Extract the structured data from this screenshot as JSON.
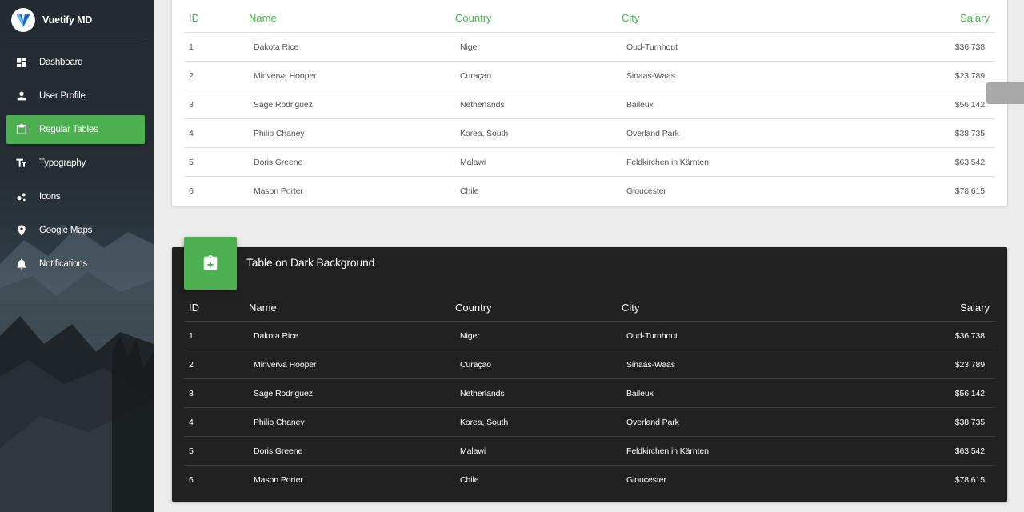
{
  "app": {
    "title": "Vuetify MD",
    "accent": "#4caf50"
  },
  "sidebar": {
    "items": [
      {
        "label": "Dashboard",
        "icon": "dashboard-icon",
        "active": false
      },
      {
        "label": "User Profile",
        "icon": "person-icon",
        "active": false
      },
      {
        "label": "Regular Tables",
        "icon": "clipboard-icon",
        "active": true
      },
      {
        "label": "Typography",
        "icon": "typography-icon",
        "active": false
      },
      {
        "label": "Icons",
        "icon": "bubble-chart-icon",
        "active": false
      },
      {
        "label": "Google Maps",
        "icon": "map-pin-icon",
        "active": false
      },
      {
        "label": "Notifications",
        "icon": "bell-icon",
        "active": false
      }
    ]
  },
  "light_table": {
    "headers": {
      "id": "ID",
      "name": "Name",
      "country": "Country",
      "city": "City",
      "salary": "Salary"
    },
    "rows": [
      {
        "id": "1",
        "name": "Dakota Rice",
        "country": "Niger",
        "city": "Oud-Turnhout",
        "salary": "$36,738"
      },
      {
        "id": "2",
        "name": "Minverva Hooper",
        "country": "Curaçao",
        "city": "Sinaas-Waas",
        "salary": "$23,789"
      },
      {
        "id": "3",
        "name": "Sage Rodriguez",
        "country": "Netherlands",
        "city": "Baileux",
        "salary": "$56,142"
      },
      {
        "id": "4",
        "name": "Philip Chaney",
        "country": "Korea, South",
        "city": "Overland Park",
        "salary": "$38,735"
      },
      {
        "id": "5",
        "name": "Doris Greene",
        "country": "Malawi",
        "city": "Feldkirchen in Kärnten",
        "salary": "$63,542"
      },
      {
        "id": "6",
        "name": "Mason Porter",
        "country": "Chile",
        "city": "Gloucester",
        "salary": "$78,615"
      }
    ]
  },
  "dark_table": {
    "title": "Table on Dark Background",
    "badge_icon": "clipboard-plus-icon",
    "headers": {
      "id": "ID",
      "name": "Name",
      "country": "Country",
      "city": "City",
      "salary": "Salary"
    },
    "rows": [
      {
        "id": "1",
        "name": "Dakota Rice",
        "country": "Niger",
        "city": "Oud-Turnhout",
        "salary": "$36,738"
      },
      {
        "id": "2",
        "name": "Minverva Hooper",
        "country": "Curaçao",
        "city": "Sinaas-Waas",
        "salary": "$23,789"
      },
      {
        "id": "3",
        "name": "Sage Rodriguez",
        "country": "Netherlands",
        "city": "Baileux",
        "salary": "$56,142"
      },
      {
        "id": "4",
        "name": "Philip Chaney",
        "country": "Korea, South",
        "city": "Overland Park",
        "salary": "$38,735"
      },
      {
        "id": "5",
        "name": "Doris Greene",
        "country": "Malawi",
        "city": "Feldkirchen in Kärnten",
        "salary": "$63,542"
      },
      {
        "id": "6",
        "name": "Mason Porter",
        "country": "Chile",
        "city": "Gloucester",
        "salary": "$78,615"
      }
    ]
  }
}
